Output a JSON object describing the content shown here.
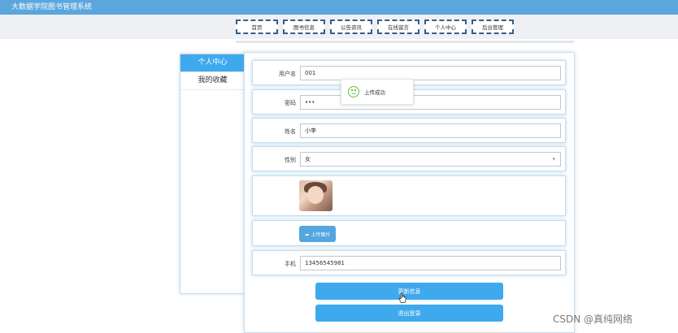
{
  "app": {
    "title": "大数据学院图书管理系统"
  },
  "nav": {
    "items": [
      "首页",
      "图书信息",
      "公告资讯",
      "在线留言",
      "个人中心",
      "后台管理"
    ]
  },
  "sidebar": {
    "items": [
      {
        "label": "个人中心",
        "active": true
      },
      {
        "label": "我的收藏",
        "active": false
      }
    ]
  },
  "form": {
    "username": {
      "label": "用户名",
      "value": "001"
    },
    "password": {
      "label": "密码",
      "value": "•••"
    },
    "name": {
      "label": "姓名",
      "value": "小李"
    },
    "gender": {
      "label": "性别",
      "value": "女"
    },
    "upload_label": "上传图片",
    "phone": {
      "label": "手机",
      "value": "13456545981"
    }
  },
  "buttons": {
    "update": "更新信息",
    "logout": "退出登录"
  },
  "toast": {
    "message": "上传成功"
  },
  "watermark": "CSDN @真纯网络",
  "colors": {
    "topbar": "#5aa6dd",
    "primary": "#3fa9ee",
    "nav_border": "#355f8a",
    "success": "#67c23a"
  }
}
